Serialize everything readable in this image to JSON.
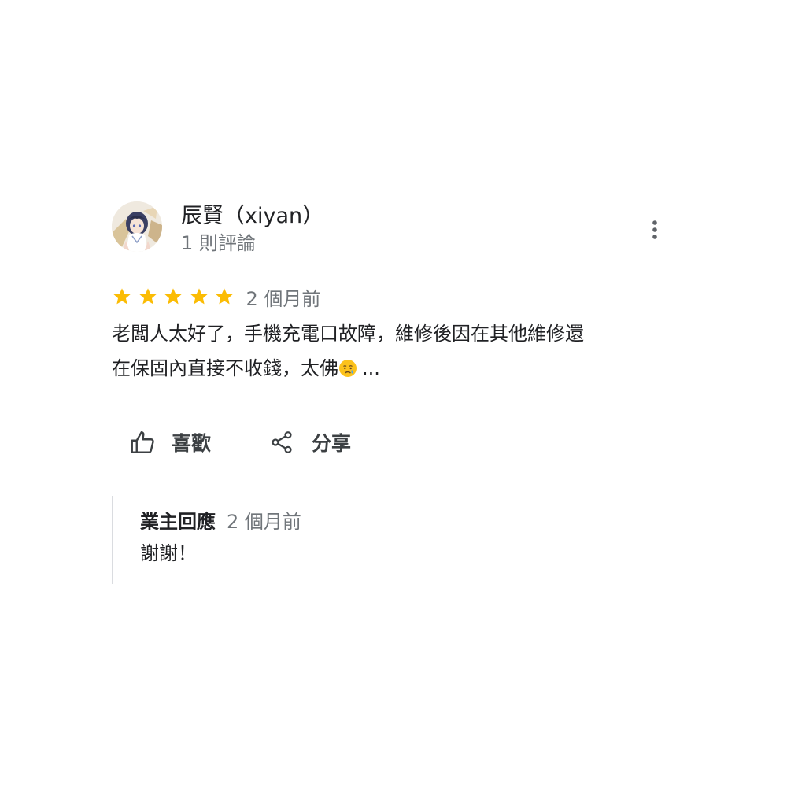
{
  "review": {
    "author": {
      "name": "辰賢（xiyan）",
      "meta": "1 則評論",
      "avatar_icon": "anime-character-avatar"
    },
    "more_options_icon": "more-vertical-icon",
    "rating": {
      "stars": 5,
      "max": 5,
      "color": "#fbbc04"
    },
    "date": "2 個月前",
    "text_line1": "老闆人太好了，手機充電口故障，維修後因在其他維修還",
    "text_line2": "在保固內直接不收錢，太佛",
    "text_emoji": "crying-face-emoji",
    "more_link": "...",
    "actions": {
      "like_label": "喜歡",
      "like_icon": "thumb-up-icon",
      "share_label": "分享",
      "share_icon": "share-icon"
    },
    "owner_reply": {
      "label": "業主回應",
      "date": "2 個月前",
      "text": "謝謝！"
    }
  }
}
